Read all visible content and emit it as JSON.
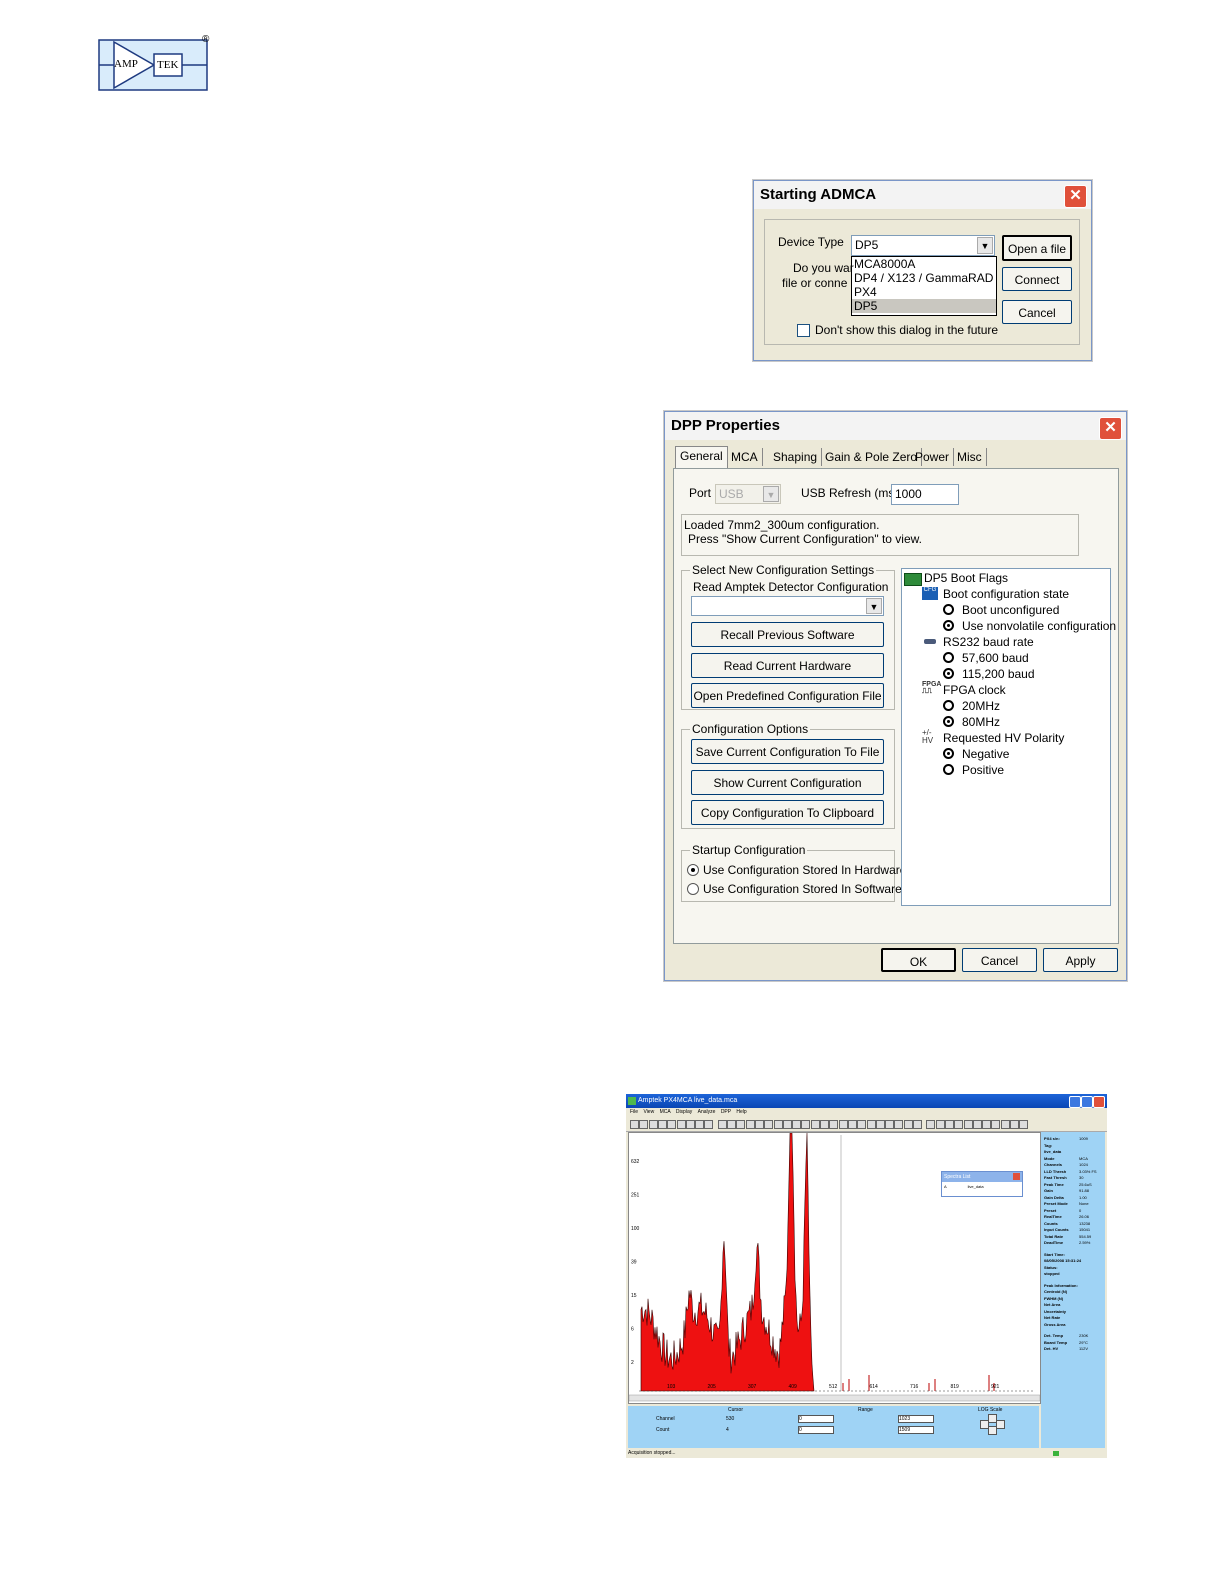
{
  "logo": {
    "left_text": "AMP",
    "right_text": "TEK",
    "registered": "®"
  },
  "starting_dialog": {
    "title": "Starting ADMCA",
    "device_type_label": "Device Type",
    "device_type_value": "DP5",
    "options": [
      "MCA8000A",
      "DP4 / X123 / GammaRAD",
      "PX4",
      "DP5"
    ],
    "selected_option": "DP5",
    "prompt_line1": "Do you war",
    "prompt_line2": "file or conne",
    "open_file_button": "Open a file",
    "connect_button": "Connect",
    "cancel_button": "Cancel",
    "dont_show_label": "Don't show this dialog in the future"
  },
  "dpp_dialog": {
    "title": "DPP Properties",
    "tabs": [
      "General",
      "MCA",
      "Shaping",
      "Gain & Pole Zero",
      "Power",
      "Misc"
    ],
    "active_tab": "General",
    "port_label": "Port",
    "port_value": "USB",
    "usb_refresh_label": "USB Refresh (ms)",
    "usb_refresh_value": "1000",
    "status_line1": "Loaded 7mm2_300um configuration.",
    "status_line2": "Press \"Show Current Configuration\" to view.",
    "select_group": {
      "title": "Select New Configuration Settings",
      "read_label": "Read Amptek Detector Configuration",
      "read_value": "",
      "recall_button": "Recall Previous Software Configuration",
      "read_hw_button": "Read Current Hardware Configuration",
      "open_predef_button": "Open Predefined Configuration File"
    },
    "options_group": {
      "title": "Configuration Options",
      "save_button": "Save Current Configuration To File",
      "show_button": "Show Current Configuration",
      "copy_button": "Copy Configuration To Clipboard"
    },
    "startup_group": {
      "title": "Startup Configuration",
      "hw_option": "Use Configuration Stored In Hardware",
      "sw_option": "Use Configuration Stored In Software",
      "selected": "hardware"
    },
    "boot_flags": {
      "root": "DP5 Boot Flags",
      "sections": [
        {
          "label": "Boot configuration state",
          "icon": "cfg-icon",
          "options": [
            "Boot unconfigured",
            "Use nonvolatile configuration"
          ],
          "selected": 1
        },
        {
          "label": "RS232 baud rate",
          "icon": "serial-icon",
          "options": [
            "57,600 baud",
            "115,200 baud"
          ],
          "selected": 1
        },
        {
          "label": "FPGA clock",
          "icon": "fpga-icon",
          "options": [
            "20MHz",
            "80MHz"
          ],
          "selected": 1
        },
        {
          "label": "Requested HV Polarity",
          "icon": "hv-icon",
          "options": [
            "Negative",
            "Positive"
          ],
          "selected": 0
        }
      ]
    },
    "ok_button": "OK",
    "cancel_button": "Cancel",
    "apply_button": "Apply"
  },
  "px4mca": {
    "title": "Amptek PX4MCA     live_data.mca",
    "menu": [
      "File",
      "View",
      "MCA",
      "Display",
      "Analyze",
      "DPP",
      "Help"
    ],
    "y_ticks": [
      "632",
      "251",
      "100",
      "39",
      "15",
      "6",
      "2"
    ],
    "x_ticks": [
      "103",
      "205",
      "307",
      "409",
      "512",
      "614",
      "716",
      "819",
      "921"
    ],
    "spectra_list": {
      "title": "Spectra List",
      "entry_letter": "A",
      "entry_name": "live_data"
    },
    "side_info": [
      [
        "PX4 s/n:",
        "1009"
      ],
      [
        "Tag:",
        ""
      ],
      [
        "live_data",
        ""
      ],
      [
        "Mode",
        "MCA"
      ],
      [
        "Channels",
        "1024"
      ],
      [
        "LLD Thresh",
        "3.03% FS"
      ],
      [
        "Fast Thresh",
        "30"
      ],
      [
        "Peak Time",
        "25.6uS"
      ],
      [
        "Gain",
        "91.88"
      ],
      [
        "Gain Delta",
        "1.00"
      ],
      [
        "Preset Mode",
        "None"
      ],
      [
        "Preset",
        "0"
      ],
      [
        "RealTime",
        "26.06"
      ],
      [
        "Counts",
        "13238"
      ],
      [
        "Input Counts",
        "15041"
      ],
      [
        "Total Rate",
        "554.59"
      ],
      [
        "DeadTime",
        "2.59%"
      ],
      [
        "Start Time:",
        ""
      ],
      [
        "08/05/2008 15:31:24",
        ""
      ],
      [
        "Status:",
        ""
      ],
      [
        "stopped",
        ""
      ],
      [
        "Peak Information:",
        ""
      ],
      [
        "Centroid (N)",
        ""
      ],
      [
        "FWHM (N)",
        ""
      ],
      [
        "Net Area",
        ""
      ],
      [
        "Uncertainty",
        ""
      ],
      [
        "Net Rate",
        ""
      ],
      [
        "Gross Area",
        ""
      ],
      [
        "Det. Temp",
        "230K"
      ],
      [
        "Board Temp",
        "29°C"
      ],
      [
        "Det. HV",
        "112V"
      ]
    ],
    "bottom": {
      "cursor_label": "Cursor",
      "range_label": "Range",
      "log_label": "LOG Scale",
      "channel_label": "Channel",
      "count_label": "Count",
      "channel_cursor": "530",
      "count_cursor": "4",
      "range_low_1": "0",
      "range_high_1": "1023",
      "range_low_2": "0",
      "range_high_2": "1509"
    },
    "status": "Acquisition stopped..."
  }
}
